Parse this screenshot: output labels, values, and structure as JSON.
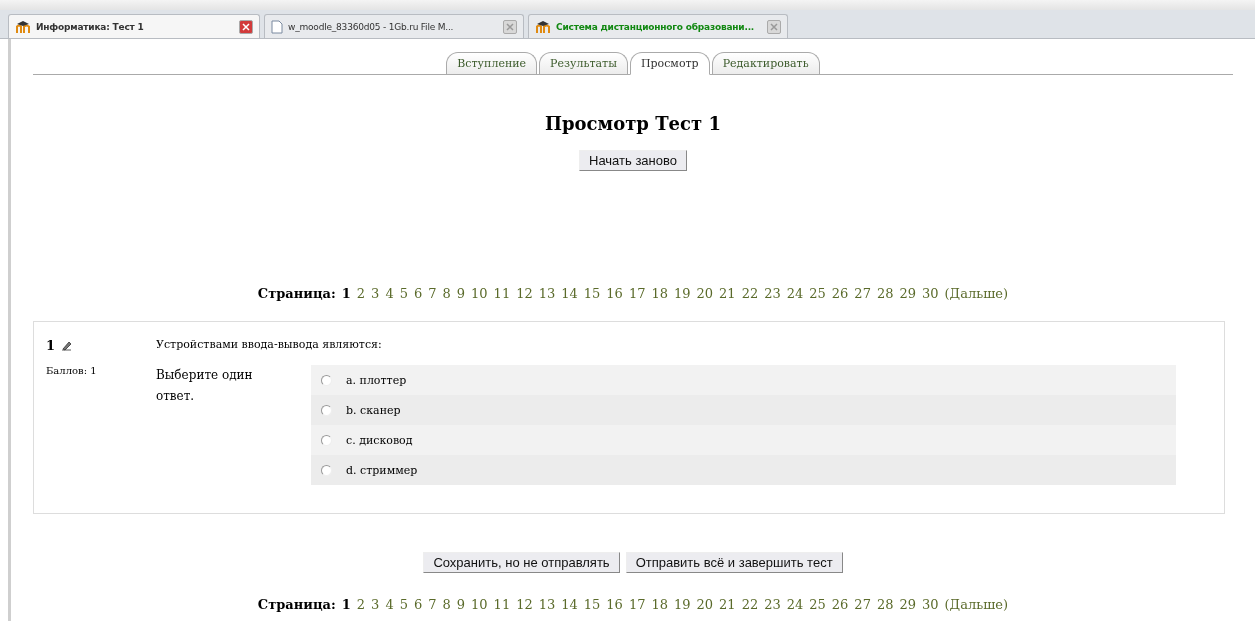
{
  "browser_tabs": [
    {
      "title": "Информатика: Тест 1",
      "kind": "moodle",
      "selected": true
    },
    {
      "title": "w_moodle_83360d05 - 1Gb.ru File M...",
      "kind": "document",
      "selected": false
    },
    {
      "title": "Система дистанционного образовани...",
      "kind": "moodle",
      "selected": false
    }
  ],
  "tabs": [
    {
      "label": "Вступление",
      "selected": false
    },
    {
      "label": "Результаты",
      "selected": false
    },
    {
      "label": "Просмотр",
      "selected": true
    },
    {
      "label": "Редактировать",
      "selected": false
    }
  ],
  "heading": "Просмотр Тест 1",
  "restart_button": "Начать заново",
  "pager_top": {
    "label": "Страница:",
    "pages": [
      {
        "label": "1",
        "selected": true
      },
      {
        "label": "2",
        "selected": false
      },
      {
        "label": "3",
        "selected": false
      },
      {
        "label": "4",
        "selected": false
      },
      {
        "label": "5",
        "selected": false
      },
      {
        "label": "6",
        "selected": false
      },
      {
        "label": "7",
        "selected": false
      },
      {
        "label": "8",
        "selected": false
      },
      {
        "label": "9",
        "selected": false
      },
      {
        "label": "10",
        "selected": false
      },
      {
        "label": "11",
        "selected": false
      },
      {
        "label": "12",
        "selected": false
      },
      {
        "label": "13",
        "selected": false
      },
      {
        "label": "14",
        "selected": false
      },
      {
        "label": "15",
        "selected": false
      },
      {
        "label": "16",
        "selected": false
      },
      {
        "label": "17",
        "selected": false
      },
      {
        "label": "18",
        "selected": false
      },
      {
        "label": "19",
        "selected": false
      },
      {
        "label": "20",
        "selected": false
      },
      {
        "label": "21",
        "selected": false
      },
      {
        "label": "22",
        "selected": false
      },
      {
        "label": "23",
        "selected": false
      },
      {
        "label": "24",
        "selected": false
      },
      {
        "label": "25",
        "selected": false
      },
      {
        "label": "26",
        "selected": false
      },
      {
        "label": "27",
        "selected": false
      },
      {
        "label": "28",
        "selected": false
      },
      {
        "label": "29",
        "selected": false
      },
      {
        "label": "30",
        "selected": false
      }
    ],
    "next": "(Дальше)"
  },
  "question": {
    "number": "1",
    "grade": "Баллов: 1",
    "text": "Устройствами ввода-вывода являются:",
    "prompt": "Выберите один ответ.",
    "options": [
      {
        "label": "a. плоттер",
        "checked": false
      },
      {
        "label": "b. сканер",
        "checked": false
      },
      {
        "label": "c. дисковод",
        "checked": false
      },
      {
        "label": "d. стриммер",
        "checked": false
      }
    ]
  },
  "actions": [
    "Сохранить, но не отправлять",
    "Отправить всё и завершить тест"
  ],
  "pager_bottom": {
    "label": "Страница:",
    "pages": [
      {
        "label": "1",
        "selected": true
      },
      {
        "label": "2",
        "selected": false
      },
      {
        "label": "3",
        "selected": false
      },
      {
        "label": "4",
        "selected": false
      },
      {
        "label": "5",
        "selected": false
      },
      {
        "label": "6",
        "selected": false
      },
      {
        "label": "7",
        "selected": false
      },
      {
        "label": "8",
        "selected": false
      },
      {
        "label": "9",
        "selected": false
      },
      {
        "label": "10",
        "selected": false
      },
      {
        "label": "11",
        "selected": false
      },
      {
        "label": "12",
        "selected": false
      },
      {
        "label": "13",
        "selected": false
      },
      {
        "label": "14",
        "selected": false
      },
      {
        "label": "15",
        "selected": false
      },
      {
        "label": "16",
        "selected": false
      },
      {
        "label": "17",
        "selected": false
      },
      {
        "label": "18",
        "selected": false
      },
      {
        "label": "19",
        "selected": false
      },
      {
        "label": "20",
        "selected": false
      },
      {
        "label": "21",
        "selected": false
      },
      {
        "label": "22",
        "selected": false
      },
      {
        "label": "23",
        "selected": false
      },
      {
        "label": "24",
        "selected": false
      },
      {
        "label": "25",
        "selected": false
      },
      {
        "label": "26",
        "selected": false
      },
      {
        "label": "27",
        "selected": false
      },
      {
        "label": "28",
        "selected": false
      },
      {
        "label": "29",
        "selected": false
      },
      {
        "label": "30",
        "selected": false
      }
    ],
    "next": "(Дальше)"
  }
}
